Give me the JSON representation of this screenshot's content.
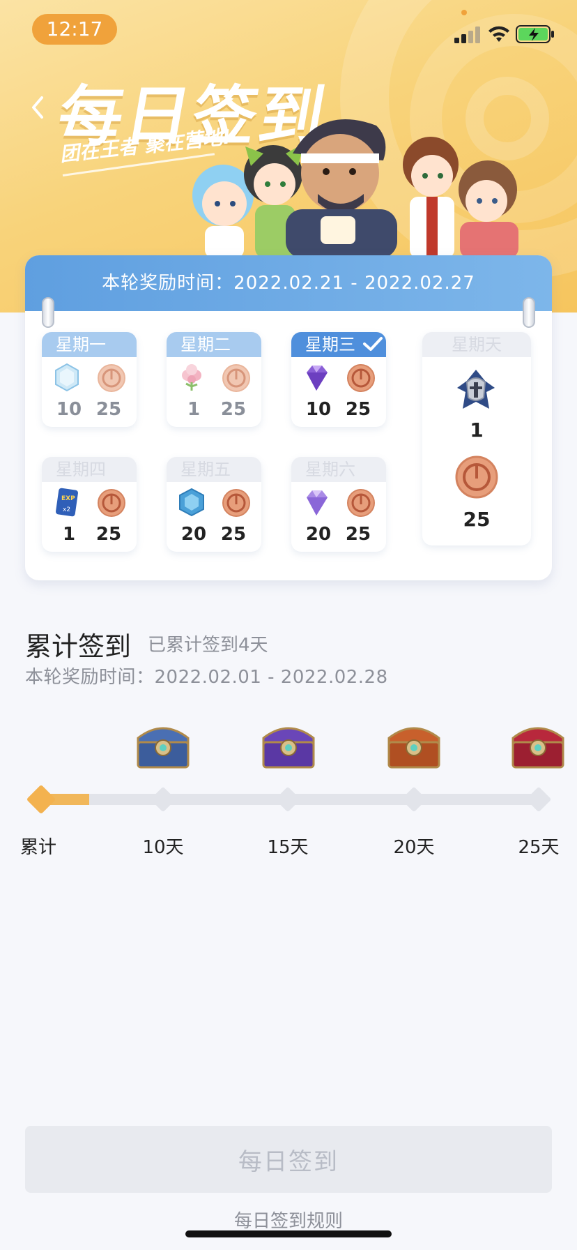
{
  "status_bar": {
    "time": "12:17"
  },
  "header": {
    "title": "每日签到",
    "slogan": "团在王者 聚在营地!"
  },
  "weekly": {
    "banner": "本轮奖励时间：2022.02.21 - 2022.02.27",
    "days": [
      {
        "label": "星期一",
        "state": "past",
        "item_icon": "ice-crystal-icon",
        "item_value": "10",
        "coin_value": "25"
      },
      {
        "label": "星期二",
        "state": "past",
        "item_icon": "flower-icon",
        "item_value": "1",
        "coin_value": "25"
      },
      {
        "label": "星期三",
        "state": "today",
        "item_icon": "purple-gem-icon",
        "item_value": "10",
        "coin_value": "25"
      },
      {
        "label": "星期四",
        "state": "future",
        "item_icon": "exp-card-icon",
        "item_value": "1",
        "coin_value": "25"
      },
      {
        "label": "星期五",
        "state": "future",
        "item_icon": "blue-crystal-icon",
        "item_value": "20",
        "coin_value": "25"
      },
      {
        "label": "星期六",
        "state": "future",
        "item_icon": "purple-gem-icon",
        "item_value": "20",
        "coin_value": "25"
      }
    ],
    "sunday": {
      "label": "星期天",
      "item_icon": "helmet-icon",
      "item_value": "1",
      "coin_value": "25"
    }
  },
  "cumulative": {
    "title": "累计签到",
    "subtitle": "已累计签到4天",
    "period": "本轮奖励时间：2022.02.01 - 2022.02.28",
    "progress_days": 4,
    "milestones": [
      {
        "label": "累计",
        "chest_color": ""
      },
      {
        "label": "10天",
        "chest_color": "#4a6fb3"
      },
      {
        "label": "15天",
        "chest_color": "#6a46b8"
      },
      {
        "label": "20天",
        "chest_color": "#c8602c"
      },
      {
        "label": "25天",
        "chest_color": "#b8283c"
      }
    ]
  },
  "actions": {
    "sign_button": "每日签到",
    "rules_link": "每日签到规则"
  },
  "colors": {
    "hero_bg": "#f8d37a",
    "accent_orange": "#f0a23b",
    "banner_blue": "#5f9fe0",
    "today_blue": "#4f8fdc",
    "progress": "#f1b75a"
  }
}
